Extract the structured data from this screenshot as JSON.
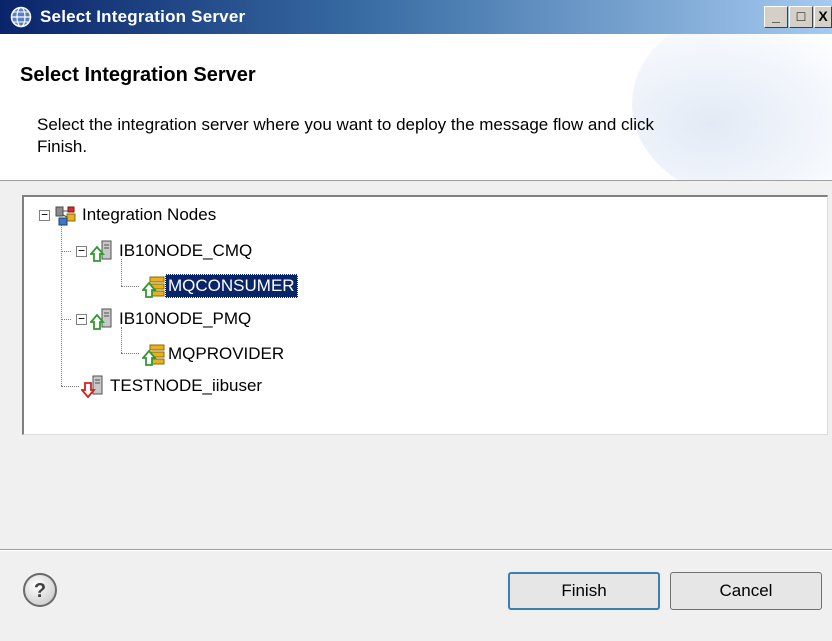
{
  "window": {
    "title": "Select Integration Server",
    "controls": {
      "minimize": "_",
      "maximize": "□",
      "close": "X"
    }
  },
  "banner": {
    "heading": "Select Integration Server",
    "description": "Select the integration server where you want to deploy the message flow and click Finish."
  },
  "tree": {
    "root": {
      "label": "Integration Nodes",
      "expander": "−"
    },
    "nodes": [
      {
        "label": "IB10NODE_CMQ",
        "expander": "−",
        "status": "running",
        "servers": [
          {
            "label": "MQCONSUMER",
            "selected": true
          }
        ]
      },
      {
        "label": "IB10NODE_PMQ",
        "expander": "−",
        "status": "running",
        "servers": [
          {
            "label": "MQPROVIDER",
            "selected": false
          }
        ]
      },
      {
        "label": "TESTNODE_iibuser",
        "status": "stopped",
        "servers": []
      }
    ]
  },
  "footer": {
    "help_icon": "?",
    "finish_label": "Finish",
    "cancel_label": "Cancel"
  },
  "colors": {
    "titlebar_start": "#0a246a",
    "selection": "#0a246a",
    "running_arrow": "#2e9a2e",
    "stopped_arrow": "#d32020"
  },
  "icons": {
    "app": "globe-icon",
    "root": "integration-nodes-icon",
    "node": "integration-node-icon",
    "server": "integration-server-icon",
    "help": "help-icon"
  }
}
